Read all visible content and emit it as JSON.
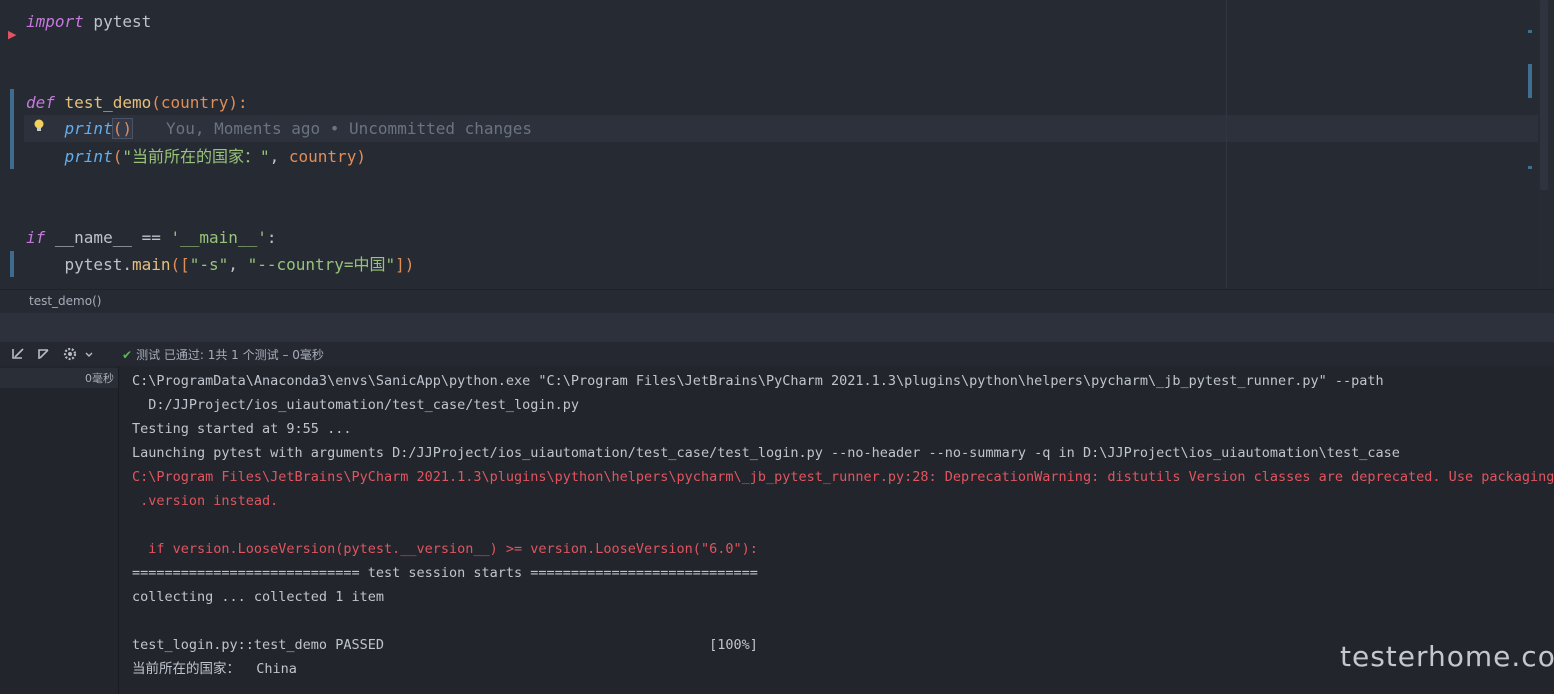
{
  "editor": {
    "lines": [
      {
        "id": "l1",
        "parts": [
          [
            "kw",
            "import"
          ],
          [
            "op",
            " pytest"
          ]
        ]
      },
      {
        "id": "l4",
        "parts": [
          [
            "kw",
            "def"
          ],
          [
            "op",
            " "
          ],
          [
            "fn",
            "test_demo"
          ],
          [
            "paren",
            "("
          ],
          [
            "param",
            "country"
          ],
          [
            "paren",
            "):"
          ]
        ]
      },
      {
        "id": "l5",
        "parts": [
          [
            "op",
            "    "
          ],
          [
            "builtin",
            "print"
          ],
          [
            "paren",
            "()"
          ]
        ]
      },
      {
        "id": "l6",
        "parts": [
          [
            "op",
            "    "
          ],
          [
            "builtin",
            "print"
          ],
          [
            "paren",
            "("
          ],
          [
            "str",
            "\"当前所在的国家：\""
          ],
          [
            "op",
            ", "
          ],
          [
            "param",
            "country"
          ],
          [
            "paren",
            ")"
          ]
        ]
      },
      {
        "id": "l9",
        "parts": [
          [
            "kw",
            "if"
          ],
          [
            "op",
            " __name__ == "
          ],
          [
            "str",
            "'__main__'"
          ],
          [
            "op",
            ":"
          ]
        ]
      },
      {
        "id": "l10",
        "parts": [
          [
            "op",
            "    pytest."
          ],
          [
            "fn",
            "main"
          ],
          [
            "paren",
            "(["
          ],
          [
            "str",
            "\"-s\""
          ],
          [
            "op",
            ", "
          ],
          [
            "str",
            "\"--country=中国\""
          ],
          [
            "paren",
            "])"
          ]
        ]
      }
    ],
    "blame": "You, Moments ago • Uncommitted changes"
  },
  "breadcrumb": "test_demo()",
  "run": {
    "status_icon": "check-icon",
    "status_text": "测试 已通过: 1共 1 个测试 – 0毫秒",
    "tree_duration": "0毫秒"
  },
  "console": [
    {
      "text": "C:\\ProgramData\\Anaconda3\\envs\\SanicApp\\python.exe \"C:\\Program Files\\JetBrains\\PyCharm 2021.1.3\\plugins\\python\\helpers\\pycharm\\_jb_pytest_runner.py\" --path",
      "err": false
    },
    {
      "text": "  D:/JJProject/ios_uiautomation/test_case/test_login.py",
      "err": false
    },
    {
      "text": "Testing started at 9:55 ...",
      "err": false
    },
    {
      "text": "Launching pytest with arguments D:/JJProject/ios_uiautomation/test_case/test_login.py --no-header --no-summary -q in D:\\JJProject\\ios_uiautomation\\test_case",
      "err": false
    },
    {
      "text": "C:\\Program Files\\JetBrains\\PyCharm 2021.1.3\\plugins\\python\\helpers\\pycharm\\_jb_pytest_runner.py:28: DeprecationWarning: distutils Version classes are deprecated. Use packaging",
      "err": true
    },
    {
      "text": " .version instead.",
      "err": true
    },
    {
      "text": "",
      "err": false
    },
    {
      "text": "  if version.LooseVersion(pytest.__version__) >= version.LooseVersion(\"6.0\"):",
      "err": true
    },
    {
      "text": "============================ test session starts ============================",
      "err": false
    },
    {
      "text": "collecting ... collected 1 item",
      "err": false
    },
    {
      "text": "",
      "err": false
    },
    {
      "text": "test_login.py::test_demo PASSED                                        [100%]",
      "err": false
    },
    {
      "text": "当前所在的国家：  China",
      "err": false
    }
  ],
  "watermark": "testerhome.com"
}
